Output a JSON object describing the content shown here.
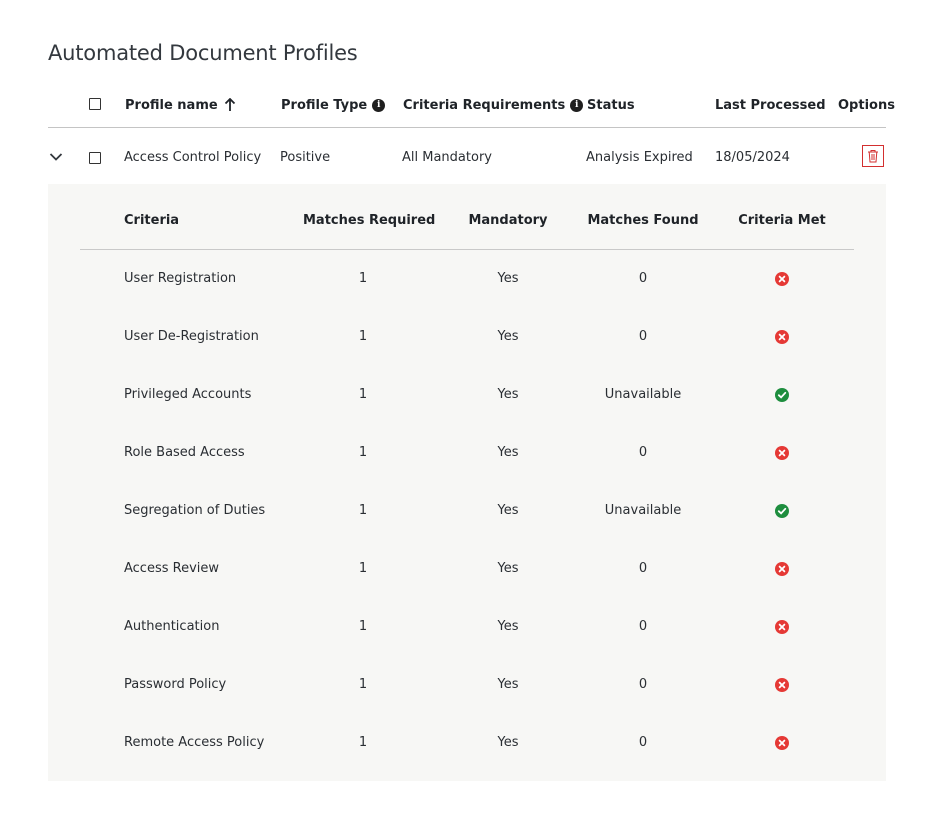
{
  "page": {
    "title": "Automated Document Profiles"
  },
  "table": {
    "headers": {
      "profile_name": "Profile name",
      "profile_type": "Profile Type",
      "criteria_requirements": "Criteria Requirements",
      "status": "Status",
      "last_processed": "Last Processed",
      "options": "Options"
    },
    "row": {
      "profile_name": "Access Control Policy",
      "profile_type": "Positive",
      "criteria_requirements": "All Mandatory",
      "status": "Analysis Expired",
      "last_processed": "18/05/2024"
    }
  },
  "criteria_table": {
    "headers": {
      "criteria": "Criteria",
      "matches_required": "Matches Required",
      "mandatory": "Mandatory",
      "matches_found": "Matches Found",
      "criteria_met": "Criteria Met"
    },
    "rows": [
      {
        "criteria": "User Registration",
        "matches_required": "1",
        "mandatory": "Yes",
        "matches_found": "0",
        "met": false
      },
      {
        "criteria": "User De-Registration",
        "matches_required": "1",
        "mandatory": "Yes",
        "matches_found": "0",
        "met": false
      },
      {
        "criteria": "Privileged Accounts",
        "matches_required": "1",
        "mandatory": "Yes",
        "matches_found": "Unavailable",
        "met": true
      },
      {
        "criteria": "Role Based Access",
        "matches_required": "1",
        "mandatory": "Yes",
        "matches_found": "0",
        "met": false
      },
      {
        "criteria": "Segregation of Duties",
        "matches_required": "1",
        "mandatory": "Yes",
        "matches_found": "Unavailable",
        "met": true
      },
      {
        "criteria": "Access Review",
        "matches_required": "1",
        "mandatory": "Yes",
        "matches_found": "0",
        "met": false
      },
      {
        "criteria": "Authentication",
        "matches_required": "1",
        "mandatory": "Yes",
        "matches_found": "0",
        "met": false
      },
      {
        "criteria": "Password Policy",
        "matches_required": "1",
        "mandatory": "Yes",
        "matches_found": "0",
        "met": false
      },
      {
        "criteria": "Remote Access Policy",
        "matches_required": "1",
        "mandatory": "Yes",
        "matches_found": "0",
        "met": false
      }
    ]
  },
  "icons": {
    "sort": "arrow-up-icon",
    "info": "info-icon",
    "expand": "chevron-down-icon",
    "delete": "trash-icon",
    "met": "check-circle-icon",
    "not_met": "x-circle-icon"
  },
  "colors": {
    "met": "#1e8e3e",
    "not_met": "#e53935",
    "delete": "#d32f2f",
    "panel_bg": "#f7f7f5"
  }
}
